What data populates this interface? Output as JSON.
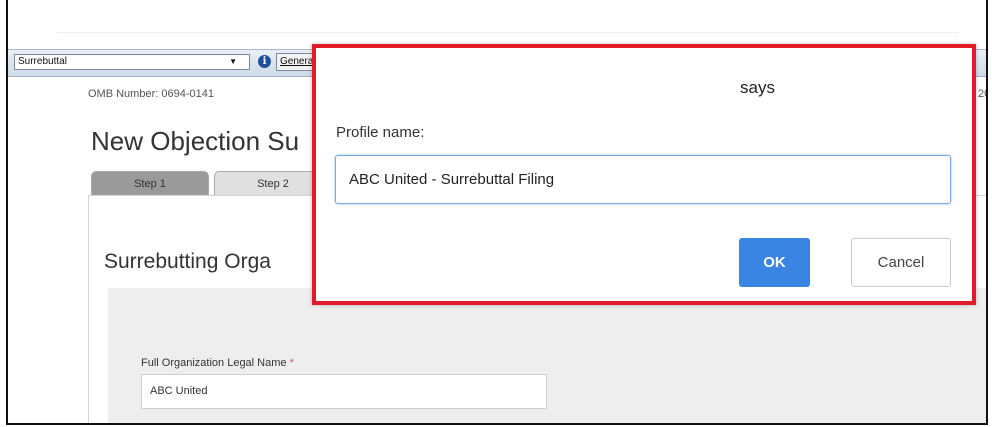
{
  "toolbar": {
    "profile_select_value": "Surrebuttal",
    "select_arrow": "▼",
    "info_icon": "i",
    "generate_button_label": "Genera"
  },
  "page": {
    "omb_number": "OMB Number: 0694-0141",
    "omb_right_fragment": "20",
    "title": "New Objection Su",
    "tabs": [
      {
        "label": "Step 1"
      },
      {
        "label": "Step 2"
      }
    ],
    "section_heading": "Surrebutting Orga",
    "field": {
      "label": "Full Organization Legal Name",
      "required_mark": "*",
      "value": "ABC United"
    }
  },
  "dialog": {
    "title": "says",
    "label": "Profile name:",
    "input_value": "ABC United - Surrebuttal Filing",
    "ok_label": "OK",
    "cancel_label": "Cancel",
    "highlight_color": "#e21b2a",
    "ok_color": "#3a84e4"
  }
}
